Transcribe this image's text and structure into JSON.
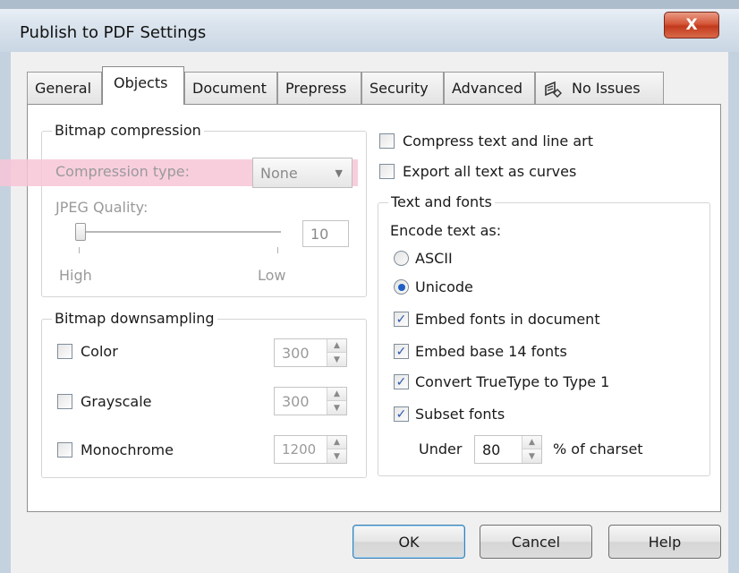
{
  "window": {
    "title": "Publish to PDF Settings",
    "close_glyph": "X"
  },
  "tabs": [
    {
      "label": "General"
    },
    {
      "label": "Objects"
    },
    {
      "label": "Document"
    },
    {
      "label": "Prepress"
    },
    {
      "label": "Security"
    },
    {
      "label": "Advanced"
    },
    {
      "label": "No Issues",
      "icon": "issues-icon"
    }
  ],
  "active_tab": "Objects",
  "bitmap_compression": {
    "legend": "Bitmap compression",
    "compression_type_label": "Compression type:",
    "compression_type_value": "None",
    "jpeg_quality_label": "JPEG Quality:",
    "jpeg_quality_value": "10",
    "slider_level": 0.0,
    "slider_high_label": "High",
    "slider_low_label": "Low"
  },
  "bitmap_downsampling": {
    "legend": "Bitmap downsampling",
    "items": [
      {
        "label": "Color",
        "checked": false,
        "value": "300"
      },
      {
        "label": "Grayscale",
        "checked": false,
        "value": "300"
      },
      {
        "label": "Monochrome",
        "checked": false,
        "value": "1200"
      }
    ]
  },
  "options": {
    "compress_text": {
      "label": "Compress text and line art",
      "checked": false
    },
    "export_curves": {
      "label": "Export all text as curves",
      "checked": false
    }
  },
  "text_and_fonts": {
    "legend": "Text and fonts",
    "encode_label": "Encode text as:",
    "ascii": {
      "label": "ASCII",
      "selected": false
    },
    "unicode": {
      "label": "Unicode",
      "selected": true
    },
    "embed_fonts": {
      "label": "Embed fonts in document",
      "checked": true
    },
    "embed_base14": {
      "label": "Embed base 14 fonts",
      "checked": true
    },
    "convert_truetype": {
      "label": "Convert TrueType to Type 1",
      "checked": true
    },
    "subset_fonts": {
      "label": "Subset fonts",
      "checked": true
    },
    "under_label": "Under",
    "under_value": "80",
    "charset_label": "% of charset"
  },
  "buttons": {
    "ok": "OK",
    "cancel": "Cancel",
    "help": "Help"
  },
  "colors": {
    "highlight": "#f7c6d7",
    "check": "#2b57b0",
    "close": "#c9472a"
  }
}
